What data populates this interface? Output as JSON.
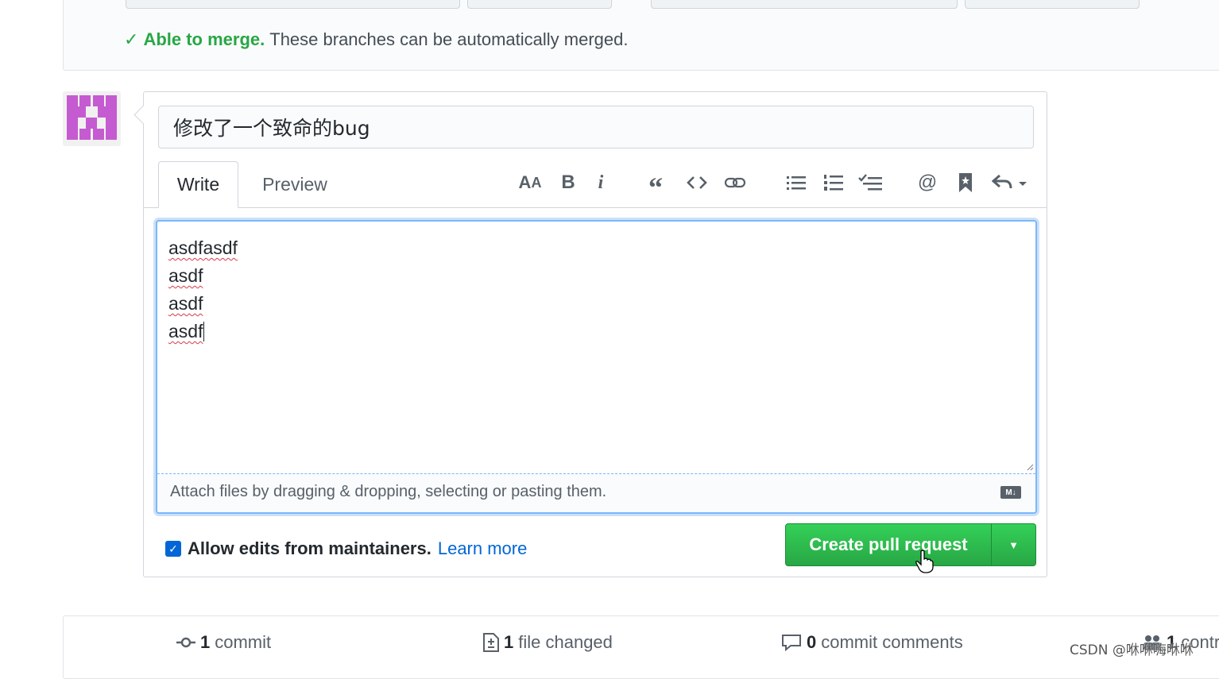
{
  "merge": {
    "status_bold": "Able to merge.",
    "status_text": "These branches can be automatically merged."
  },
  "form": {
    "title_value": "修改了一个致命的bug",
    "tabs": {
      "write": "Write",
      "preview": "Preview"
    },
    "toolbar_icons": [
      "text-size-icon",
      "bold-icon",
      "italic-icon",
      "quote-icon",
      "code-icon",
      "link-icon",
      "unordered-list-icon",
      "ordered-list-icon",
      "task-list-icon",
      "mention-icon",
      "bookmark-icon",
      "reply-icon"
    ],
    "body_lines": [
      "asdfasdf",
      "asdf",
      "asdf",
      "asdf"
    ],
    "attach_text": "Attach files by dragging & dropping, selecting or pasting them.",
    "markdown_badge": "M↓"
  },
  "allow_edits": {
    "checked": true,
    "label": "Allow edits from maintainers.",
    "link": "Learn more"
  },
  "create_button": {
    "label": "Create pull request"
  },
  "stats": {
    "commits_count": "1",
    "commits_label": "commit",
    "files_count": "1",
    "files_label": "file changed",
    "comments_count": "0",
    "comments_label": "commit comments",
    "contributors_count": "1",
    "contributors_label": "contributor"
  },
  "watermark": "CSDN @咻咻嗨咻咻"
}
